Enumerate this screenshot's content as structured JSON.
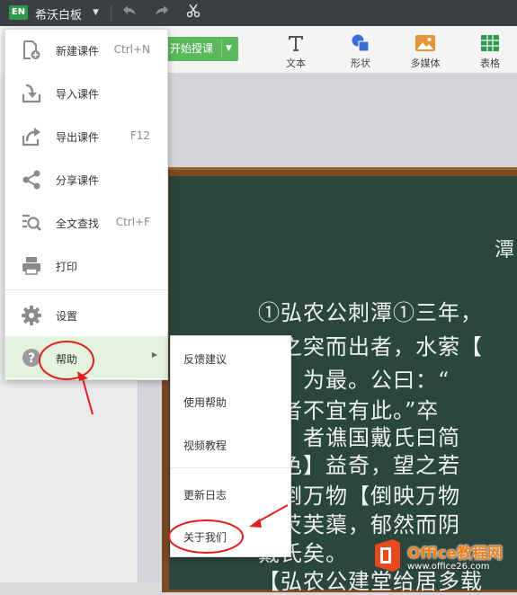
{
  "app": {
    "logo": "EN",
    "name": "希沃白板",
    "caret_icon": "caret-down-icon"
  },
  "titlebar_icons": [
    "undo-icon",
    "redo-icon",
    "scissors-icon"
  ],
  "toolbar": {
    "start_label": "开始授课",
    "tools": [
      {
        "label": "文本",
        "icon": "text-icon",
        "color": "#555555"
      },
      {
        "label": "形状",
        "icon": "shape-icon",
        "color": "#3b6fd6"
      },
      {
        "label": "多媒体",
        "icon": "image-icon",
        "color": "#e5943a"
      },
      {
        "label": "表格",
        "icon": "table-icon",
        "color": "#2e9a49"
      }
    ]
  },
  "menu": {
    "items": [
      {
        "label": "新建课件",
        "shortcut": "Ctrl+N",
        "icon": "new-file-icon"
      },
      {
        "label": "导入课件",
        "shortcut": "",
        "icon": "import-icon"
      },
      {
        "label": "导出课件",
        "shortcut": "F12",
        "icon": "export-icon"
      },
      {
        "label": "分享课件",
        "shortcut": "",
        "icon": "share-icon"
      },
      {
        "label": "全文查找",
        "shortcut": "Ctrl+F",
        "icon": "search-doc-icon"
      },
      {
        "label": "打印",
        "shortcut": "",
        "icon": "printer-icon"
      },
      {
        "label": "设置",
        "shortcut": "",
        "icon": "gear-icon"
      },
      {
        "label": "帮助",
        "shortcut": "",
        "icon": "help-icon"
      }
    ]
  },
  "submenu": {
    "items": [
      {
        "label": "反馈建议"
      },
      {
        "label": "使用帮助"
      },
      {
        "label": "视频教程"
      },
      {
        "label": "更新日志"
      },
      {
        "label": "关于我们"
      }
    ]
  },
  "board": {
    "title": "潭",
    "lines": [
      "①弘农公刺潭①三年，",
      "岸之突而出者，水萦【",
      "里】为最。公曰：“",
      "】者不宜有此。”卒",
      "秀】者谯国戴氏曰简",
      "景色】益奇，望之若",
      "颠倒万物【倒映万物",
      "菱芡芙蕖，郁然而阴",
      "戴氏矣。",
      "【弘农公建堂给居多载"
    ]
  },
  "watermark": {
    "title": "Office教程网",
    "url": "www.office26.com"
  },
  "colors": {
    "accent_green": "#5cb85c",
    "annotation_red": "#e02020",
    "board": "#2b463d"
  }
}
